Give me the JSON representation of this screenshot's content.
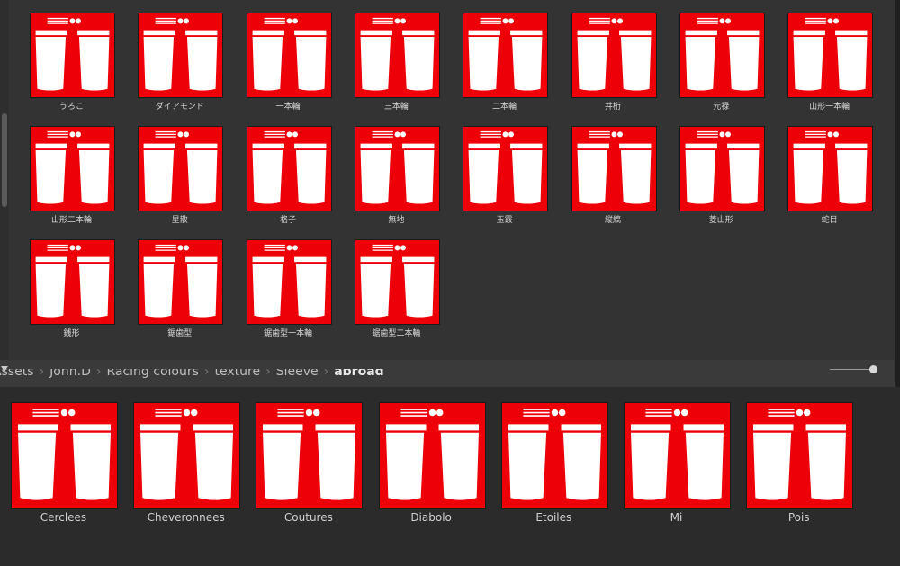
{
  "colors": {
    "silk_red": "#ed0008",
    "pattern_black": "#000000",
    "pattern_white": "#ffffff"
  },
  "breadcrumb": {
    "items": [
      "Assets",
      "John.D",
      "Racing colours",
      "texture",
      "Sleeve",
      "abroad"
    ],
    "separator": "›"
  },
  "japanese_sleeves": [
    {
      "label": "うろこ",
      "pattern": "uroko"
    },
    {
      "label": "ダイアモンド",
      "pattern": "diamond"
    },
    {
      "label": "一本輪",
      "pattern": "ring1"
    },
    {
      "label": "三本輪",
      "pattern": "ring3"
    },
    {
      "label": "二本輪",
      "pattern": "ring2"
    },
    {
      "label": "井桁",
      "pattern": "igeta"
    },
    {
      "label": "元禄",
      "pattern": "genroku"
    },
    {
      "label": "山形一本輪",
      "pattern": "zigzag1"
    },
    {
      "label": "山形二本輪",
      "pattern": "zigzag2"
    },
    {
      "label": "星散",
      "pattern": "stars"
    },
    {
      "label": "格子",
      "pattern": "lattice"
    },
    {
      "label": "無地",
      "pattern": "plain"
    },
    {
      "label": "玉霰",
      "pattern": "dots"
    },
    {
      "label": "縦縞",
      "pattern": "vstripes"
    },
    {
      "label": "菱山形",
      "pattern": "diamondband"
    },
    {
      "label": "蛇目",
      "pattern": "rings"
    },
    {
      "label": "銭形",
      "pattern": "coins"
    },
    {
      "label": "鋸歯型",
      "pattern": "saw"
    },
    {
      "label": "鋸歯型一本輪",
      "pattern": "saw1"
    },
    {
      "label": "鋸歯型二本輪",
      "pattern": "saw2"
    }
  ],
  "abroad_sleeves": [
    {
      "label": "Cerclees",
      "pattern": "hoops"
    },
    {
      "label": "Cheveronnees",
      "pattern": "chevrons"
    },
    {
      "label": "Coutures",
      "pattern": "seams"
    },
    {
      "label": "Diabolo",
      "pattern": "diabolo"
    },
    {
      "label": "Etoiles",
      "pattern": "etoiles"
    },
    {
      "label": "Mi",
      "pattern": "mi"
    },
    {
      "label": "Pois",
      "pattern": "pois"
    }
  ]
}
